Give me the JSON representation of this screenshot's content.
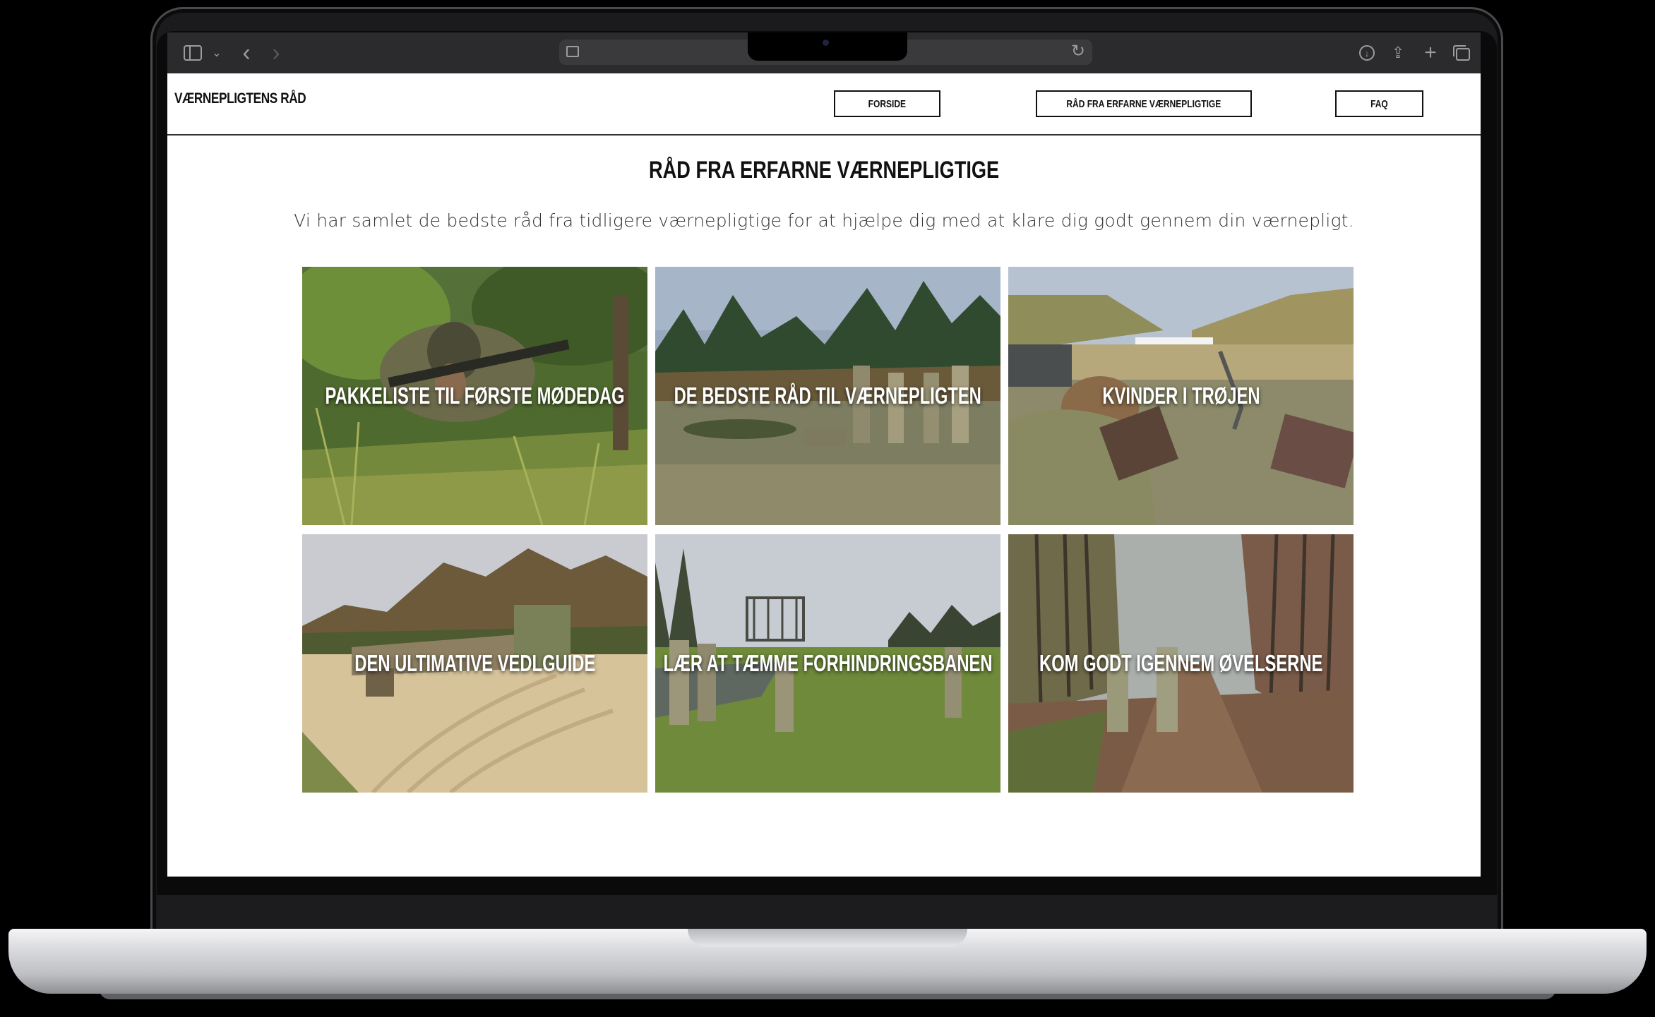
{
  "browser": {
    "toolbar_color": "#2b2b2d"
  },
  "site": {
    "logo": "VÆRNEPLIGTENS RÅD",
    "nav": [
      {
        "label": "FORSIDE"
      },
      {
        "label": "RÅD FRA ERFARNE VÆRNEPLIGTIGE"
      },
      {
        "label": "FAQ"
      }
    ]
  },
  "main": {
    "title": "RÅD FRA ERFARNE VÆRNEPLIGTIGE",
    "intro": "Vi har samlet de bedste råd fra tidligere værnepligtige for at hjælpe dig med at klare dig godt gennem din værnepligt.",
    "cards": [
      {
        "label": "PAKKELISTE TIL FØRSTE MØDEDAG"
      },
      {
        "label": "DE BEDSTE RÅD TIL VÆRNEPLIGTEN"
      },
      {
        "label": "KVINDER I TRØJEN"
      },
      {
        "label": "DEN ULTIMATIVE VEDLGUIDE"
      },
      {
        "label": "LÆR AT TÆMME FORHINDRINGSBANEN"
      },
      {
        "label": "KOM GODT IGENNEM ØVELSERNE"
      }
    ]
  }
}
